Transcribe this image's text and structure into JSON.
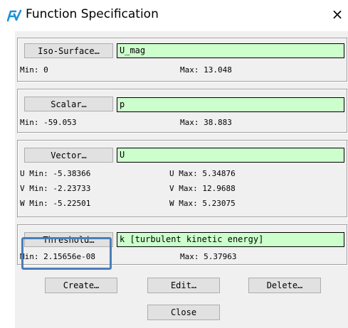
{
  "window": {
    "title": "Function Specification",
    "icon": "fv-logo-icon",
    "close_glyph": "×"
  },
  "iso_surface": {
    "button_label": "Iso-Surface…",
    "value": "U_mag",
    "min_text": "Min: 0",
    "max_text": "Max: 13.048"
  },
  "scalar": {
    "button_label": "Scalar…",
    "value": "p",
    "min_text": "Min: -59.053",
    "max_text": "Max: 38.883"
  },
  "vector": {
    "button_label": "Vector…",
    "value": "U",
    "u_min_text": "U Min: -5.38366",
    "u_max_text": "U Max: 5.34876",
    "v_min_text": "V Min: -2.23733",
    "v_max_text": "V Max: 12.9688",
    "w_min_text": "W Min: -5.22501",
    "w_max_text": "W Max: 5.23075"
  },
  "threshold": {
    "button_label": "Threshold…",
    "value": "k [turbulent kinetic energy]",
    "min_text": "Min: 2.15656e-08",
    "max_text": "Max: 5.37963"
  },
  "actions": {
    "create_label": "Create…",
    "edit_label": "Edit…",
    "delete_label": "Delete…",
    "close_label": "Close"
  },
  "colors": {
    "field_background": "#ccffcc",
    "highlight_border": "#4a7eba",
    "dialog_background": "#f0f0f0",
    "icon_color": "#1e90d6"
  }
}
